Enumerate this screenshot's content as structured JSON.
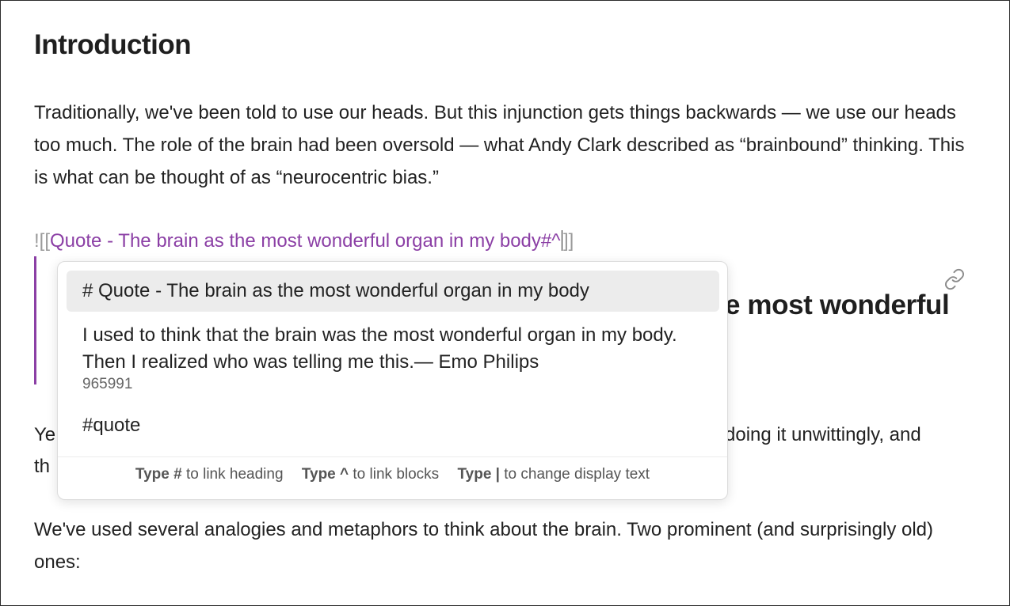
{
  "document": {
    "heading": "Introduction",
    "paragraph1": "Traditionally, we've been told to use our heads. But this injunction gets things backwards — we use our heads too much. The role of the brain had been oversold — what Andy Clark described as “brainbound” thinking. This is what can be thought of as “neurocentric bias.”",
    "embed": {
      "open_brackets": "![[",
      "link_text": "Quote - The brain as the most wonderful organ in my body#^",
      "close_brackets": "]]"
    },
    "embedded_heading_visible": "e most wonderful",
    "para2_fragment_left_1": "Ye",
    "para2_fragment_left_2": "th",
    "para2_fragment_right": "doing it unwittingly, and",
    "paragraph3": "We've used several analogies and metaphors to think about the brain. Two prominent (and surprisingly old) ones:"
  },
  "icons": {
    "link": "link-icon"
  },
  "colors": {
    "link_purple": "#8b3fa5",
    "bracket_gray": "#9a9a9a",
    "selected_bg": "#ececec"
  },
  "suggestions": {
    "selected_heading": "# Quote - The brain as the most wonderful organ in my body",
    "block_text": "I used to think that the brain was the most wonderful organ in my body. Then I realized who was telling me this.— Emo Philips",
    "block_id": "965991",
    "tag": "#quote"
  },
  "footer_hints": [
    {
      "key": "Type #",
      "text": "to link heading"
    },
    {
      "key": "Type ^",
      "text": "to link blocks"
    },
    {
      "key": "Type |",
      "text": "to change display text"
    }
  ]
}
